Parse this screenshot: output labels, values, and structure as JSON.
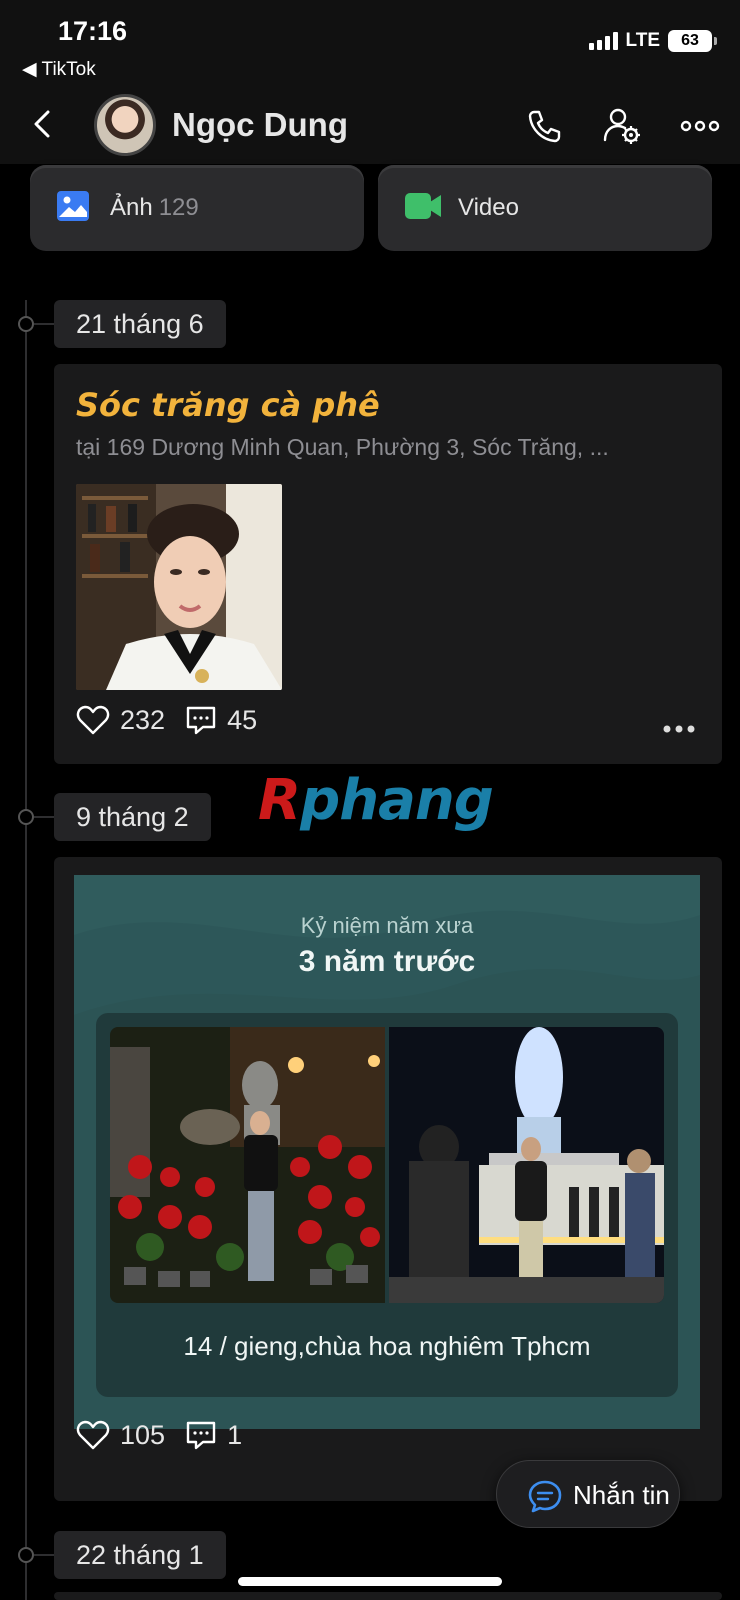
{
  "status_bar": {
    "time": "17:16",
    "back_app": "◀ TikTok",
    "network": "LTE",
    "battery": "63"
  },
  "header": {
    "contact_name": "Ngọc Dung"
  },
  "media": {
    "photos_label": "Ảnh",
    "photos_count": "129",
    "video_label": "Video"
  },
  "timeline": [
    {
      "date": "21 tháng 6",
      "place_title": "Sóc trăng cà phê",
      "address": "tại 169 Dương Minh Quan, Phường 3, Sóc Trăng, ...",
      "likes": "232",
      "comments": "45"
    },
    {
      "date": "9 tháng 2",
      "memory_subtitle": "Kỷ niệm năm xưa",
      "memory_title": "3 năm trước",
      "memory_caption": "14 /  gieng,chùa hoa nghiêm Tphcm",
      "likes": "105",
      "comments": "1"
    },
    {
      "date": "22 tháng 1"
    }
  ],
  "chat_button": {
    "label": "Nhắn tin"
  },
  "watermark": {
    "part1": "R",
    "part2": "phang"
  },
  "colors": {
    "accent_title": "#f2b33c",
    "photo_icon": "#3a7bf2",
    "video_icon": "#3fbf6a",
    "memory_bg": "#2c5455"
  }
}
